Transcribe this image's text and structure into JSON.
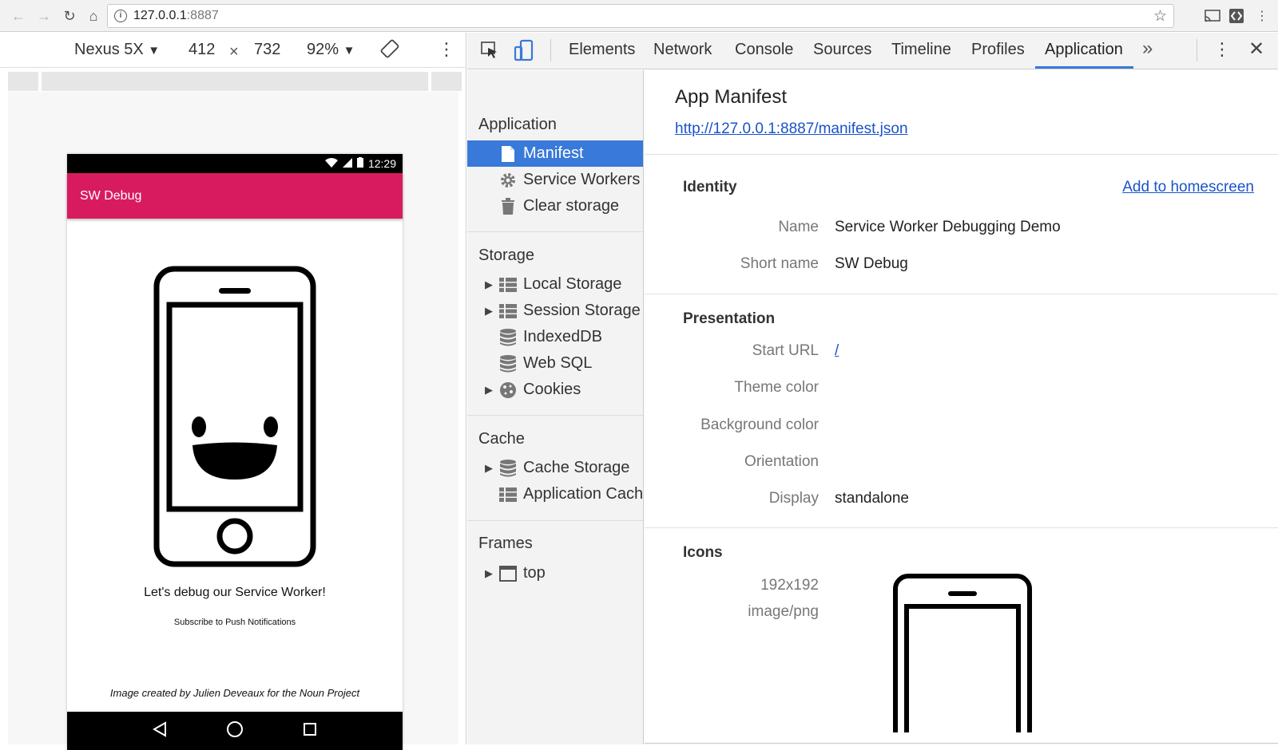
{
  "browser": {
    "url_host": "127.0.0.1",
    "url_port": ":8887"
  },
  "device_toolbar": {
    "device": "Nexus 5X",
    "width": "412",
    "times": "×",
    "height": "732",
    "zoom": "92%"
  },
  "phone": {
    "time": "12:29",
    "app_title": "SW Debug",
    "tagline": "Let's debug our Service Worker!",
    "subscribe": "Subscribe to Push Notifications",
    "credit": "Image created by Julien Deveaux for the Noun Project"
  },
  "devtools": {
    "tabs": [
      "Elements",
      "Network",
      "Console",
      "Sources",
      "Timeline",
      "Profiles",
      "Application"
    ],
    "active_tab": "Application",
    "more_tabs": "»"
  },
  "sidebar": {
    "application_header": "Application",
    "application_items": [
      "Manifest",
      "Service Workers",
      "Clear storage"
    ],
    "storage_header": "Storage",
    "storage_items": [
      "Local Storage",
      "Session Storage",
      "IndexedDB",
      "Web SQL",
      "Cookies"
    ],
    "cache_header": "Cache",
    "cache_items": [
      "Cache Storage",
      "Application Cache"
    ],
    "frames_header": "Frames",
    "frames_items": [
      "top"
    ]
  },
  "manifest": {
    "title": "App Manifest",
    "url": "http://127.0.0.1:8887/manifest.json",
    "identity_header": "Identity",
    "add_to_homescreen": "Add to homescreen",
    "name_label": "Name",
    "name_value": "Service Worker Debugging Demo",
    "short_name_label": "Short name",
    "short_name_value": "SW Debug",
    "presentation_header": "Presentation",
    "start_url_label": "Start URL",
    "start_url_value": "/",
    "theme_color_label": "Theme color",
    "background_color_label": "Background color",
    "orientation_label": "Orientation",
    "display_label": "Display",
    "display_value": "standalone",
    "icons_header": "Icons",
    "icon_size": "192x192",
    "icon_type": "image/png"
  },
  "colors": {
    "app_bar": "#d81b5f",
    "selection": "#3879d9",
    "link": "#1a53c9"
  }
}
